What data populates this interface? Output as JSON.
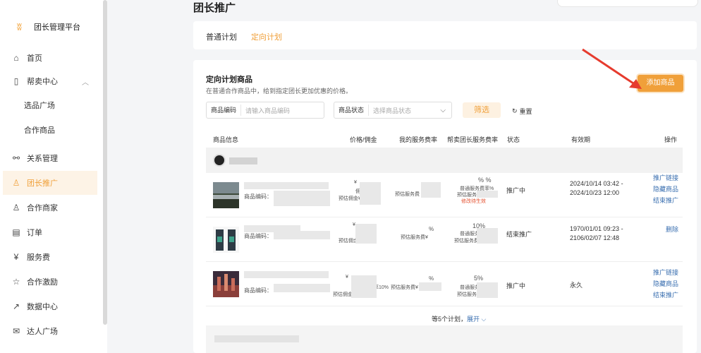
{
  "brand": {
    "name": "团长管理平台"
  },
  "sidebar": {
    "items": [
      {
        "label": "首页"
      },
      {
        "label": "帮卖中心"
      },
      {
        "label": "选品广场"
      },
      {
        "label": "合作商品"
      },
      {
        "label": "关系管理"
      },
      {
        "label": "团长推广"
      },
      {
        "label": "合作商家"
      },
      {
        "label": "订单"
      },
      {
        "label": "服务费"
      },
      {
        "label": "合作激励"
      },
      {
        "label": "数据中心"
      },
      {
        "label": "达人广场"
      }
    ]
  },
  "header": {
    "title": "团长推广"
  },
  "tabs": [
    {
      "label": "普通计划"
    },
    {
      "label": "定向计划"
    }
  ],
  "section": {
    "title": "定向计划商品",
    "desc": "在普通合作商品中，给到指定团长更加优惠的价格。"
  },
  "add_button": "添加商品",
  "filters": {
    "code_label": "商品编码",
    "code_placeholder": "请输入商品编码",
    "status_label": "商品状态",
    "status_placeholder": "选择商品状态",
    "filter_btn": "筛选",
    "reset": "重置"
  },
  "table": {
    "headers": [
      "商品信息",
      "价格/佣金",
      "我的服务费率",
      "帮卖团长服务费率",
      "状态",
      "有效期",
      "操作"
    ],
    "rows": [
      {
        "code_label": "商品编码：",
        "price": "¥",
        "commission_rate": "佣金率",
        "est_commission": "预估佣金¥",
        "my_fee": "预估服务费",
        "help_rate": "% %",
        "normal_fee": "普通服务费率%",
        "est_fee": "预估服务费¥",
        "warn": "修改待生效",
        "status": "推广中",
        "period1": "2024/10/14 03:42 -",
        "period2": "2024/10/23 12:00",
        "actions": [
          "推广链接",
          "隐藏商品",
          "结束推广"
        ]
      },
      {
        "code_label": "商品编码：",
        "price": "¥",
        "commission_rate": "%",
        "est_commission": "预估佣金¥",
        "my_fee_rate": "%",
        "my_fee": "预估服务费¥",
        "help_rate": "10%",
        "normal_fee": "普通服务费率",
        "est_fee": "预估服务费¥",
        "status": "结束推广",
        "period1": "1970/01/01 09:23 -",
        "period2": "2106/02/07 12:48",
        "actions": [
          "删除"
        ]
      },
      {
        "code_label": "商品编码：",
        "price": "¥",
        "commission_rate": "佣金率10%",
        "est_commission": "预估佣金¥",
        "my_fee_rate": "%",
        "my_fee": "预估服务费¥",
        "help_rate": "5%",
        "normal_fee": "普通服务费率",
        "est_fee": "预估服务费¥",
        "status": "推广中",
        "period1": "永久",
        "actions": [
          "推广链接",
          "隐藏商品",
          "结束推广"
        ]
      }
    ]
  },
  "more": {
    "text": "等5个计划，",
    "link": "展开 ⌵"
  },
  "colors": {
    "accent": "#f0a03a",
    "link": "#3a6fb0",
    "warn": "#e4502f"
  }
}
